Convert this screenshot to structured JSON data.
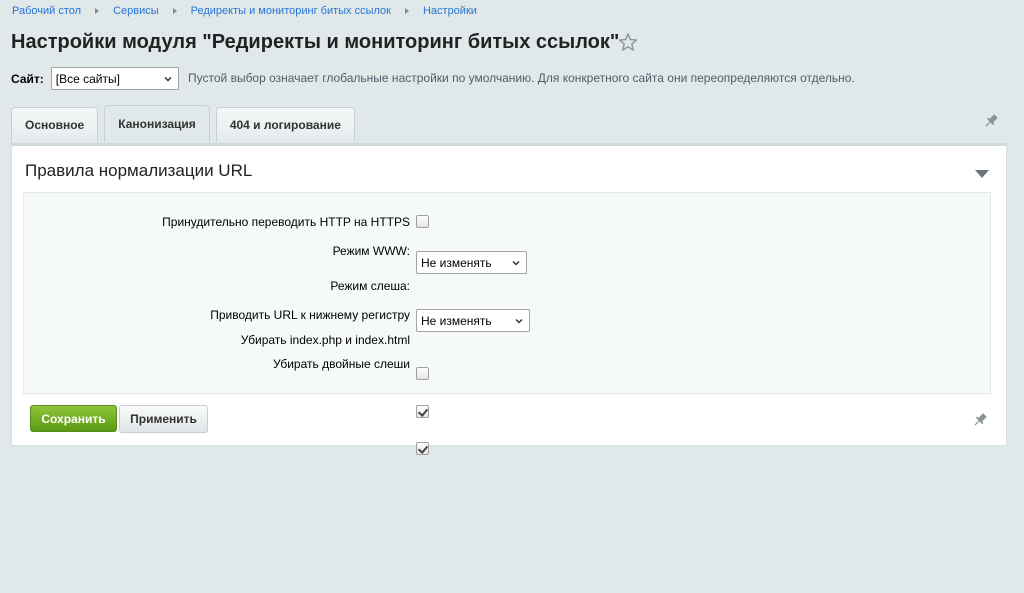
{
  "breadcrumb": [
    "Рабочий стол",
    "Сервисы",
    "Редиректы и мониторинг битых ссылок",
    "Настройки"
  ],
  "page_title": "Настройки модуля \"Редиректы и мониторинг битых ссылок\"",
  "site": {
    "label": "Сайт:",
    "selected": "[Все сайты]",
    "hint": "Пустой выбор означает глобальные настройки по умолчанию. Для конкретного сайта они переопределяются отдельно."
  },
  "tabs": [
    {
      "label": "Основное",
      "active": false
    },
    {
      "label": "Канонизация",
      "active": true
    },
    {
      "label": "404 и логирование",
      "active": false
    }
  ],
  "section": {
    "title": "Правила нормализации URL",
    "fields": {
      "https": {
        "label": "Принудительно переводить HTTP на HTTPS",
        "checked": false
      },
      "www": {
        "label": "Режим WWW:",
        "value": "Не изменять"
      },
      "slash": {
        "label": "Режим слеша:",
        "value": "Не изменять"
      },
      "lowercase": {
        "label": "Приводить URL к нижнему регистру",
        "checked": false
      },
      "index": {
        "label": "Убирать index.php и index.html",
        "checked": true
      },
      "double_slash": {
        "label": "Убирать двойные слеши",
        "checked": true
      }
    }
  },
  "buttons": {
    "save": "Сохранить",
    "apply": "Применить"
  },
  "colors": {
    "accent_link": "#2675d7",
    "save_green": "#6aab1e",
    "background": "#e0e8ea"
  }
}
